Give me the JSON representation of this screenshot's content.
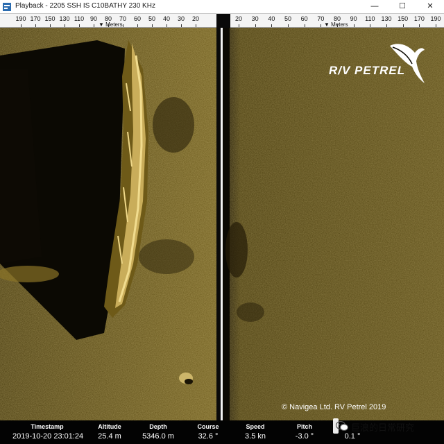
{
  "window": {
    "title": "Playback - 2205 SSH IS C10BATHY 230 KHz",
    "minimize_glyph": "—",
    "maximize_glyph": "☐",
    "close_glyph": "✕"
  },
  "rulers": {
    "units": "Meters",
    "left_ticks": [
      "190",
      "170",
      "150",
      "130",
      "110",
      "90",
      "80",
      "70",
      "60",
      "50",
      "40",
      "30",
      "20"
    ],
    "right_ticks": [
      "20",
      "30",
      "40",
      "50",
      "60",
      "70",
      "80",
      "90",
      "110",
      "130",
      "150",
      "170",
      "190"
    ]
  },
  "brand": {
    "name": "R/V PETREL",
    "copyright": "© Navigea Ltd. RV Petrel 2019"
  },
  "status": {
    "timestamp_label": "Timestamp",
    "timestamp_value": "2019-10-20 23:01:24",
    "altitude_label": "Altitude",
    "altitude_value": "25.4 m",
    "depth_label": "Depth",
    "depth_value": "5346.0 m",
    "course_label": "Course",
    "course_value": "32.6 °",
    "speed_label": "Speed",
    "speed_value": "3.5 kn",
    "pitch_label": "Pitch",
    "pitch_value": "-3.0 °",
    "roll_value": "0.1 °"
  },
  "watermark": {
    "text": "巨浪的日常研究"
  },
  "colors": {
    "seabed": "#6b5a1c",
    "shadow": "#0b0903",
    "wreck_highlight": "#efd889"
  }
}
